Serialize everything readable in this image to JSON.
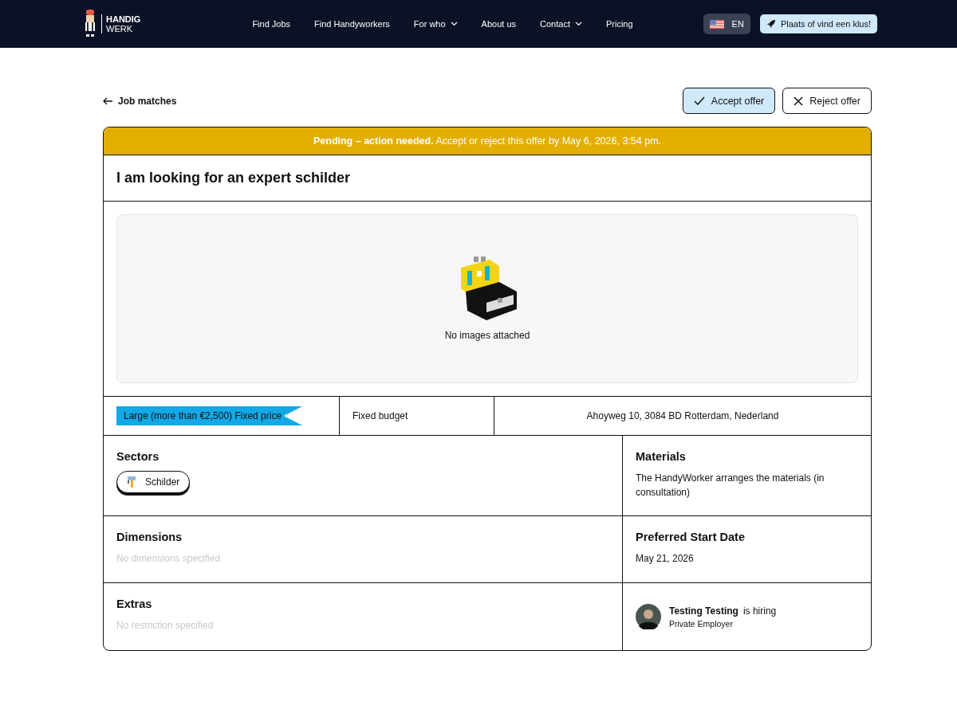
{
  "header": {
    "logo": {
      "line1": "HANDIG",
      "line2": "WERK"
    },
    "nav": [
      {
        "label": "Find Jobs",
        "dropdown": false
      },
      {
        "label": "Find Handyworkers",
        "dropdown": false
      },
      {
        "label": "For who",
        "dropdown": true
      },
      {
        "label": "About us",
        "dropdown": false
      },
      {
        "label": "Contact",
        "dropdown": true
      },
      {
        "label": "Pricing",
        "dropdown": false
      }
    ],
    "language": "EN",
    "cta": "Plaats of vind een klus!"
  },
  "back_link": "Job matches",
  "actions": [
    {
      "label": "Accept offer",
      "kind": "accept"
    },
    {
      "label": "Reject offer",
      "kind": "reject"
    }
  ],
  "banner": "**Pending – action needed.** Accept or reject this offer by May 6, 2026, 3:54 pm.",
  "title": "I am looking for an expert schilder",
  "images": {
    "empty_text": "No images attached"
  },
  "info": {
    "size_tag": "Large (more than €2,500) Fixed price",
    "budget": "Fixed budget",
    "address": "Ahoyweg 10, 3084 BD Rotterdam, Nederland"
  },
  "sections": {
    "sectors": {
      "title": "Sectors",
      "chips": [
        "Schilder"
      ]
    },
    "materials": {
      "title": "Materials",
      "text": "The HandyWorker arranges the materials (in consultation)"
    },
    "dimensions": {
      "title": "Dimensions",
      "text": "No dimensions specified",
      "empty": true
    },
    "start_date": {
      "title": "Preferred Start Date",
      "text": "May 21, 2026",
      "empty": false
    },
    "extras": {
      "title": "Extras",
      "text": "No restriction specified",
      "empty": true
    }
  },
  "employer": {
    "name": "Testing Testing",
    "suffix": "is hiring",
    "type": "Private Employer"
  }
}
